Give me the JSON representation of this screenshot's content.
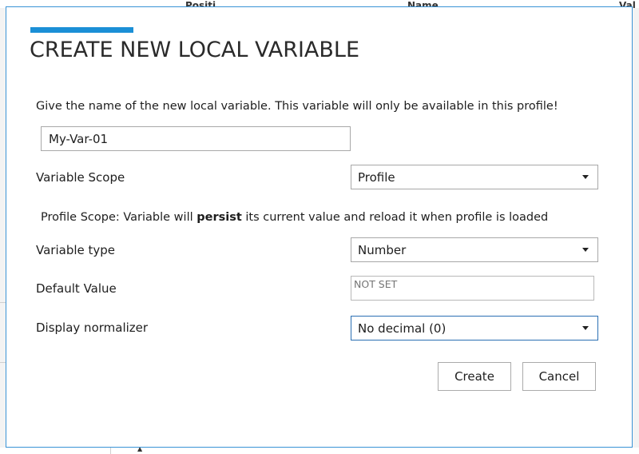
{
  "background": {
    "fragments": [
      "Positi",
      "Name",
      "Val"
    ],
    "bottom_glyph": "▲"
  },
  "dialog": {
    "title": "CREATE NEW LOCAL VARIABLE",
    "accent_color": "#1b8fd6",
    "intro": "Give the name of the new local variable. This variable will only be available in this profile!",
    "name_input": {
      "value": "My-Var-01"
    },
    "scope": {
      "label": "Variable Scope",
      "selected": "Profile"
    },
    "scope_note": {
      "prefix": "Profile Scope: Variable will ",
      "emphasis": "persist",
      "suffix": " its current value and reload it when profile is loaded"
    },
    "type": {
      "label": "Variable type",
      "selected": "Number"
    },
    "default_value": {
      "label": "Default Value",
      "placeholder": "NOT SET"
    },
    "normalizer": {
      "label": "Display normalizer",
      "selected": "No decimal (0)"
    },
    "buttons": {
      "create": "Create",
      "cancel": "Cancel"
    }
  }
}
